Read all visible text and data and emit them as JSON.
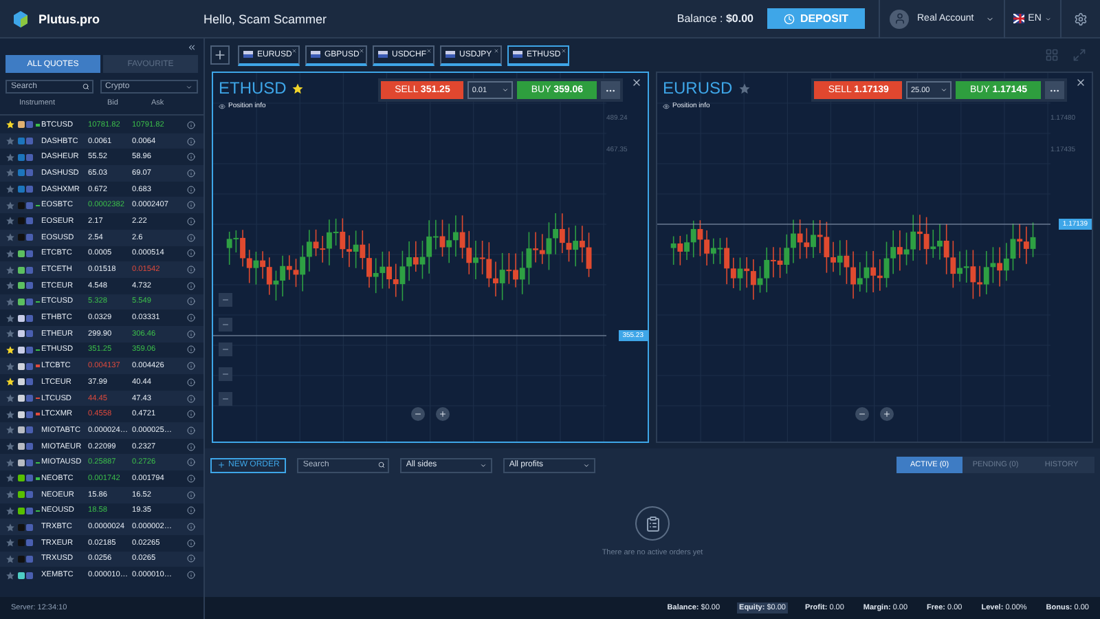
{
  "header": {
    "brand": "Plutus.pro",
    "greeting": "Hello, Scam Scammer",
    "balance_label": "Balance :",
    "balance_value": "$0.00",
    "deposit": "DEPOSIT",
    "account": "Real Account",
    "language": "EN"
  },
  "sidebar": {
    "tabs": [
      {
        "label": "ALL QUOTES",
        "selected": true
      },
      {
        "label": "FAVOURITE",
        "selected": false
      }
    ],
    "search": {
      "placeholder": "Search"
    },
    "category": "Crypto",
    "columns": [
      "Instrument",
      "Bid",
      "Ask"
    ],
    "rows": [
      {
        "favorite": true,
        "color": "#e0b070",
        "rising": true,
        "falling": false,
        "name": "BTCUSD",
        "bid": "10781.82",
        "bid_up": true,
        "bid_down": false,
        "ask": "10791.82",
        "ask_up": true,
        "ask_down": false
      },
      {
        "favorite": false,
        "color": "#1c75bc",
        "rising": false,
        "falling": false,
        "name": "DASHBTC",
        "bid": "0.0061",
        "bid_up": false,
        "bid_down": false,
        "ask": "0.0064",
        "ask_up": false,
        "ask_down": false
      },
      {
        "favorite": false,
        "color": "#1c75bc",
        "rising": false,
        "falling": false,
        "name": "DASHEUR",
        "bid": "55.52",
        "bid_up": false,
        "bid_down": false,
        "ask": "58.96",
        "ask_up": false,
        "ask_down": false
      },
      {
        "favorite": false,
        "color": "#1c75bc",
        "rising": false,
        "falling": false,
        "name": "DASHUSD",
        "bid": "65.03",
        "bid_up": false,
        "bid_down": false,
        "ask": "69.07",
        "ask_up": false,
        "ask_down": false
      },
      {
        "favorite": false,
        "color": "#1c75bc",
        "rising": false,
        "falling": false,
        "name": "DASHXMR",
        "bid": "0.672",
        "bid_up": false,
        "bid_down": false,
        "ask": "0.683",
        "ask_up": false,
        "ask_down": false
      },
      {
        "favorite": false,
        "color": "#111111",
        "rising": true,
        "falling": false,
        "name": "EOSBTC",
        "bid": "0.0002382",
        "bid_up": true,
        "bid_down": false,
        "ask": "0.0002407",
        "ask_up": false,
        "ask_down": false
      },
      {
        "favorite": false,
        "color": "#111111",
        "rising": false,
        "falling": false,
        "name": "EOSEUR",
        "bid": "2.17",
        "bid_up": false,
        "bid_down": false,
        "ask": "2.22",
        "ask_up": false,
        "ask_down": false
      },
      {
        "favorite": false,
        "color": "#111111",
        "rising": false,
        "falling": false,
        "name": "EOSUSD",
        "bid": "2.54",
        "bid_up": false,
        "bid_down": false,
        "ask": "2.6",
        "ask_up": false,
        "ask_down": false
      },
      {
        "favorite": false,
        "color": "#5cbf60",
        "rising": false,
        "falling": false,
        "name": "ETCBTC",
        "bid": "0.0005",
        "bid_up": false,
        "bid_down": false,
        "ask": "0.000514",
        "ask_up": false,
        "ask_down": false
      },
      {
        "favorite": false,
        "color": "#5cbf60",
        "rising": false,
        "falling": false,
        "name": "ETCETH",
        "bid": "0.01518",
        "bid_up": false,
        "bid_down": false,
        "ask": "0.01542",
        "ask_up": false,
        "ask_down": true
      },
      {
        "favorite": false,
        "color": "#5cbf60",
        "rising": false,
        "falling": false,
        "name": "ETCEUR",
        "bid": "4.548",
        "bid_up": false,
        "bid_down": false,
        "ask": "4.732",
        "ask_up": false,
        "ask_down": false
      },
      {
        "favorite": false,
        "color": "#5cbf60",
        "rising": true,
        "falling": false,
        "name": "ETCUSD",
        "bid": "5.328",
        "bid_up": true,
        "bid_down": false,
        "ask": "5.549",
        "ask_up": true,
        "ask_down": false
      },
      {
        "favorite": false,
        "color": "#c8cde8",
        "rising": false,
        "falling": false,
        "name": "ETHBTC",
        "bid": "0.0329",
        "bid_up": false,
        "bid_down": false,
        "ask": "0.03331",
        "ask_up": false,
        "ask_down": false
      },
      {
        "favorite": false,
        "color": "#c8cde8",
        "rising": false,
        "falling": false,
        "name": "ETHEUR",
        "bid": "299.90",
        "bid_up": false,
        "bid_down": false,
        "ask": "306.46",
        "ask_up": true,
        "ask_down": false
      },
      {
        "favorite": true,
        "color": "#c8cde8",
        "rising": true,
        "falling": false,
        "name": "ETHUSD",
        "bid": "351.25",
        "bid_up": true,
        "bid_down": false,
        "ask": "359.06",
        "ask_up": true,
        "ask_down": false
      },
      {
        "favorite": false,
        "color": "#d0d4dc",
        "rising": false,
        "falling": true,
        "name": "LTCBTC",
        "bid": "0.004137",
        "bid_up": false,
        "bid_down": true,
        "ask": "0.004426",
        "ask_up": false,
        "ask_down": false
      },
      {
        "favorite": true,
        "color": "#d0d4dc",
        "rising": false,
        "falling": false,
        "name": "LTCEUR",
        "bid": "37.99",
        "bid_up": false,
        "bid_down": false,
        "ask": "40.44",
        "ask_up": false,
        "ask_down": false
      },
      {
        "favorite": false,
        "color": "#d0d4dc",
        "rising": false,
        "falling": true,
        "name": "LTCUSD",
        "bid": "44.45",
        "bid_up": false,
        "bid_down": true,
        "ask": "47.43",
        "ask_up": false,
        "ask_down": false
      },
      {
        "favorite": false,
        "color": "#d0d4dc",
        "rising": false,
        "falling": true,
        "name": "LTCXMR",
        "bid": "0.4558",
        "bid_up": false,
        "bid_down": true,
        "ask": "0.4721",
        "ask_up": false,
        "ask_down": false
      },
      {
        "favorite": false,
        "color": "#b8bcc4",
        "rising": false,
        "falling": false,
        "name": "MIOTABTC",
        "bid": "0.000024…",
        "bid_up": false,
        "bid_down": false,
        "ask": "0.000025…",
        "ask_up": false,
        "ask_down": false
      },
      {
        "favorite": false,
        "color": "#b8bcc4",
        "rising": false,
        "falling": false,
        "name": "MIOTAEUR",
        "bid": "0.22099",
        "bid_up": false,
        "bid_down": false,
        "ask": "0.2327",
        "ask_up": false,
        "ask_down": false
      },
      {
        "favorite": false,
        "color": "#b8bcc4",
        "rising": true,
        "falling": false,
        "name": "MIOTAUSD",
        "bid": "0.25887",
        "bid_up": true,
        "bid_down": false,
        "ask": "0.2726",
        "ask_up": true,
        "ask_down": false
      },
      {
        "favorite": false,
        "color": "#58bf00",
        "rising": true,
        "falling": false,
        "name": "NEOBTC",
        "bid": "0.001742",
        "bid_up": true,
        "bid_down": false,
        "ask": "0.001794",
        "ask_up": false,
        "ask_down": false
      },
      {
        "favorite": false,
        "color": "#58bf00",
        "rising": false,
        "falling": false,
        "name": "NEOEUR",
        "bid": "15.86",
        "bid_up": false,
        "bid_down": false,
        "ask": "16.52",
        "ask_up": false,
        "ask_down": false
      },
      {
        "favorite": false,
        "color": "#58bf00",
        "rising": true,
        "falling": false,
        "name": "NEOUSD",
        "bid": "18.58",
        "bid_up": true,
        "bid_down": false,
        "ask": "19.35",
        "ask_up": false,
        "ask_down": false
      },
      {
        "favorite": false,
        "color": "#111111",
        "rising": false,
        "falling": false,
        "name": "TRXBTC",
        "bid": "0.0000024",
        "bid_up": false,
        "bid_down": false,
        "ask": "0.000002…",
        "ask_up": false,
        "ask_down": false
      },
      {
        "favorite": false,
        "color": "#111111",
        "rising": false,
        "falling": false,
        "name": "TRXEUR",
        "bid": "0.02185",
        "bid_up": false,
        "bid_down": false,
        "ask": "0.02265",
        "ask_up": false,
        "ask_down": false
      },
      {
        "favorite": false,
        "color": "#111111",
        "rising": false,
        "falling": false,
        "name": "TRXUSD",
        "bid": "0.0256",
        "bid_up": false,
        "bid_down": false,
        "ask": "0.0265",
        "ask_up": false,
        "ask_down": false
      },
      {
        "favorite": false,
        "color": "#4ecdc4",
        "rising": false,
        "falling": false,
        "name": "XEMBTC",
        "bid": "0.000010…",
        "bid_up": false,
        "bid_down": false,
        "ask": "0.000010…",
        "ask_up": false,
        "ask_down": false
      }
    ],
    "server": "Server: 12:34:10"
  },
  "symbol_tabs": [
    {
      "label": "EURUSD",
      "selected": false
    },
    {
      "label": "GBPUSD",
      "selected": false
    },
    {
      "label": "USDCHF",
      "selected": false
    },
    {
      "label": "USDJPY",
      "selected": false
    },
    {
      "label": "ETHUSD",
      "selected": true
    }
  ],
  "charts": [
    {
      "symbol": "ETHUSD",
      "favorite": true,
      "selected": true,
      "sell": "SELL",
      "sell_price": "351.25",
      "amount": "0.01",
      "buy": "BUY",
      "buy_price": "359.06",
      "position_info": "Position info",
      "axis_labels": [
        "489.24",
        "467.35"
      ],
      "price_tag": "355.23",
      "tools": true
    },
    {
      "symbol": "EURUSD",
      "favorite": false,
      "selected": false,
      "sell": "SELL",
      "sell_price": "1.17139",
      "amount": "25.00",
      "buy": "BUY",
      "buy_price": "1.17145",
      "position_info": "Position info",
      "axis_labels": [
        "1.17480",
        "1.17435"
      ],
      "price_tag": "1.17139",
      "tools": false
    }
  ],
  "orders": {
    "new_order": "NEW ORDER",
    "search": {
      "placeholder": "Search"
    },
    "filters": [
      "All sides",
      "All profits"
    ],
    "tabs": [
      {
        "label": "ACTIVE (0)",
        "selected": true
      },
      {
        "label": "PENDING (0)",
        "selected": false
      },
      {
        "label": "HISTORY",
        "selected": false
      }
    ],
    "empty_message": "There are no active orders yet"
  },
  "status_bar": [
    {
      "label": "Balance:",
      "value": "$0.00",
      "highlighted": false
    },
    {
      "label": "Equity:",
      "value": "$0.00",
      "highlighted": true
    },
    {
      "label": "Profit:",
      "value": "0.00",
      "highlighted": false
    },
    {
      "label": "Margin:",
      "value": "0.00",
      "highlighted": false
    },
    {
      "label": "Free:",
      "value": "0.00",
      "highlighted": false
    },
    {
      "label": "Level:",
      "value": "0.00%",
      "highlighted": false
    },
    {
      "label": "Bonus:",
      "value": "0.00",
      "highlighted": false
    }
  ]
}
